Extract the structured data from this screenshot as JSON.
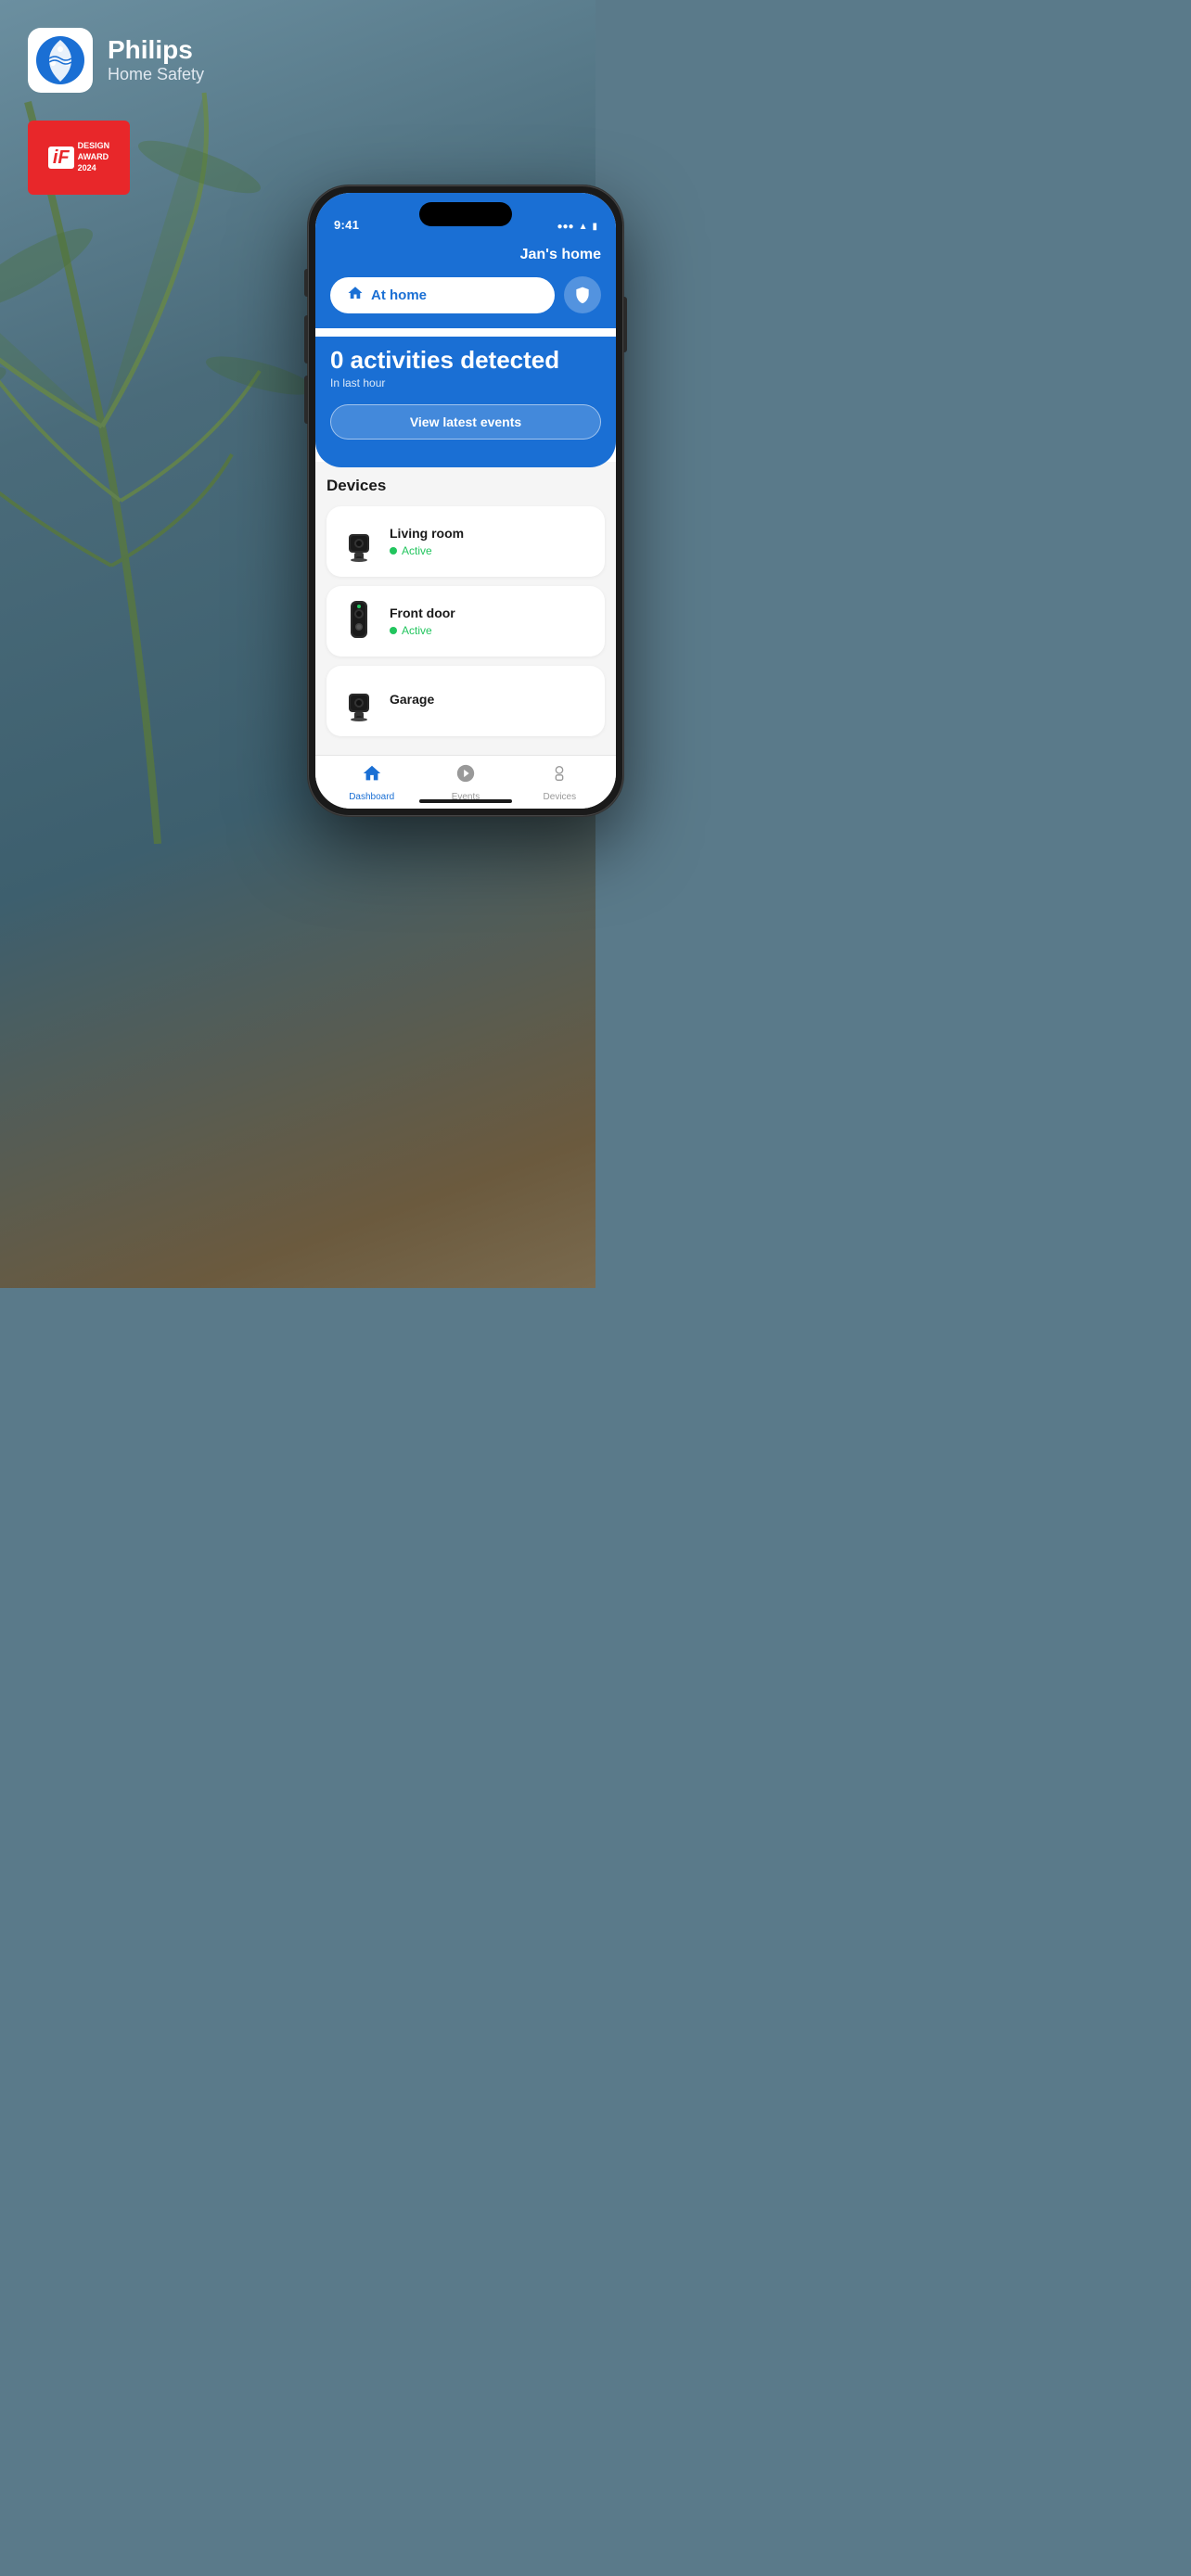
{
  "app": {
    "name": "Philips",
    "subtitle": "Home Safety",
    "award": {
      "label_if": "iF",
      "label_design": "DESIGN",
      "label_award": "AWARD",
      "label_year": "2024"
    }
  },
  "phone": {
    "status_bar": {
      "time": "9:41"
    },
    "header": {
      "home_name": "Jan's home",
      "mode_label": "At home",
      "shield_label": "Shield"
    },
    "activity": {
      "count_text": "0 activities detected",
      "subtitle": "In last hour",
      "button_label": "View latest events"
    },
    "devices_section": {
      "title": "Devices",
      "items": [
        {
          "name": "Living room",
          "status": "Active",
          "type": "indoor_camera"
        },
        {
          "name": "Front door",
          "status": "Active",
          "type": "doorbell"
        },
        {
          "name": "Garage",
          "status": "",
          "type": "indoor_camera"
        }
      ]
    },
    "bottom_nav": {
      "items": [
        {
          "label": "Dashboard",
          "icon": "home",
          "active": true
        },
        {
          "label": "Events",
          "icon": "events",
          "active": false
        },
        {
          "label": "Devices",
          "icon": "devices",
          "active": false
        }
      ]
    }
  }
}
